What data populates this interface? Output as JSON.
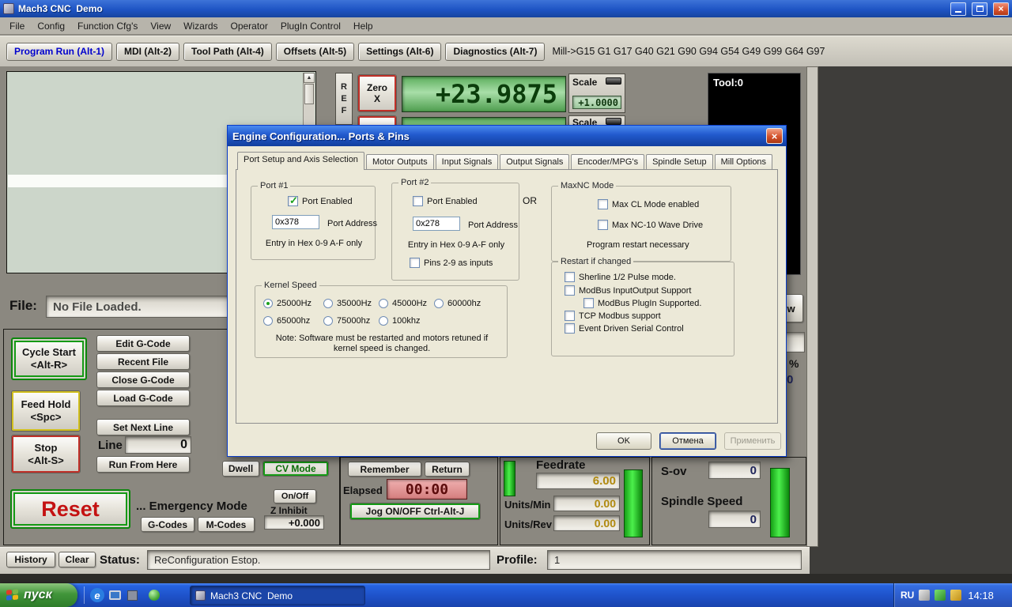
{
  "icons": {
    "close": "×",
    "scroll_up": "▲",
    "scroll_down": "▼",
    "ie": "e"
  },
  "titlebar": {
    "title": "Mach3 CNC  Demo"
  },
  "menu": {
    "items": [
      "File",
      "Config",
      "Function Cfg's",
      "View",
      "Wizards",
      "Operator",
      "PlugIn Control",
      "Help"
    ]
  },
  "screen_tabs": {
    "items": [
      "Program Run (Alt-1)",
      "MDI (Alt-2)",
      "Tool Path (Alt-4)",
      "Offsets (Alt-5)",
      "Settings (Alt-6)",
      "Diagnostics (Alt-7)"
    ],
    "gcode_modes": "Mill->G15 G1 G17 G40 G21 G90 G94 G54 G49 G99 G64 G97"
  },
  "dro": {
    "ref": [
      "R",
      "E",
      "F"
    ],
    "zero_x_line1": "Zero",
    "zero_x_line2": "X",
    "x_value": "+23.9875",
    "scale_label": "Scale",
    "scale_value": "+1.0000",
    "scale2_label": "Scale",
    "tool_label": "Tool:0"
  },
  "file_bar": {
    "label": "File:",
    "value": "No File Loaded.",
    "partial_button": "w"
  },
  "fro": {
    "percent": "%",
    "value": "0"
  },
  "left_panel": {
    "cycle_start_line1": "Cycle Start",
    "cycle_start_line2": "<Alt-R>",
    "edit_gcode": "Edit G-Code",
    "recent_file": "Recent File",
    "close_gcode": "Close G-Code",
    "load_gcode": "Load G-Code",
    "set_next_line": "Set Next Line",
    "line_label": "Line",
    "line_value": "0",
    "run_from_here": "Run From Here",
    "feed_hold_line1": "Feed Hold",
    "feed_hold_line2": "<Spc>",
    "stop_line1": "Stop",
    "stop_line2": "<Alt-S>",
    "dwell": "Dwell",
    "cv_mode": "CV Mode",
    "reset": "Reset",
    "emergency": "... Emergency Mode",
    "gcodes": "G-Codes",
    "mcodes": "M-Codes",
    "onoff": "On/Off",
    "z_inhibit_label": "Z Inhibit",
    "z_inhibit_value": "+0.000"
  },
  "jog_panel": {
    "remember": "Remember",
    "return": "Return",
    "elapsed_label": "Elapsed",
    "elapsed_value": "00:00",
    "jog_toggle": "Jog ON/OFF Ctrl-Alt-J"
  },
  "feedrate_panel": {
    "title": "Feedrate",
    "value": "6.00",
    "units_min_label": "Units/Min",
    "units_min_value": "0.00",
    "units_rev_label": "Units/Rev",
    "units_rev_value": "0.00"
  },
  "spindle_panel": {
    "sov_label": "S-ov",
    "sov_value": "0",
    "title": "Spindle Speed",
    "speed_value": "0"
  },
  "status_bar": {
    "history": "History",
    "clear": "Clear",
    "status_label": "Status:",
    "status_value": "ReConfiguration Estop.",
    "profile_label": "Profile:",
    "profile_value": "1"
  },
  "dialog": {
    "title": "Engine Configuration... Ports & Pins",
    "tabs": [
      "Port Setup and Axis Selection",
      "Motor Outputs",
      "Input Signals",
      "Output Signals",
      "Encoder/MPG's",
      "Spindle Setup",
      "Mill Options"
    ],
    "port1": {
      "legend": "Port #1",
      "enabled_label": "Port Enabled",
      "enabled": true,
      "address_value": "0x378",
      "address_label": "Port Address",
      "hint": "Entry in Hex 0-9 A-F only"
    },
    "port2": {
      "legend": "Port #2",
      "enabled_label": "Port Enabled",
      "enabled": false,
      "address_value": "0x278",
      "address_label": "Port Address",
      "hint": "Entry in Hex 0-9 A-F only",
      "pins_label": "Pins 2-9 as inputs",
      "pins_checked": false
    },
    "or_label": "OR",
    "maxnc": {
      "legend": "MaxNC Mode",
      "cl_mode": "Max CL Mode enabled",
      "wave_drive": "Max NC-10 Wave Drive",
      "note": "Program restart necessary"
    },
    "kernel": {
      "legend": "Kernel Speed",
      "options": [
        "25000Hz",
        "35000Hz",
        "45000Hz",
        "60000hz",
        "65000hz",
        "75000hz",
        "100khz"
      ],
      "selected": "25000Hz",
      "note_line1": "Note: Software must be restarted and motors retuned if",
      "note_line2": "kernel speed is changed."
    },
    "restart": {
      "legend": "Restart if changed",
      "items": [
        "Sherline 1/2 Pulse mode.",
        "ModBus InputOutput Support",
        "ModBus PlugIn Supported.",
        "TCP Modbus support",
        "Event Driven Serial Control"
      ]
    },
    "ok": "OK",
    "cancel": "Отмена",
    "apply": "Применить"
  },
  "taskbar": {
    "start": "пуск",
    "task": "Mach3 CNC  Demo",
    "lang": "RU",
    "time": "14:18"
  }
}
